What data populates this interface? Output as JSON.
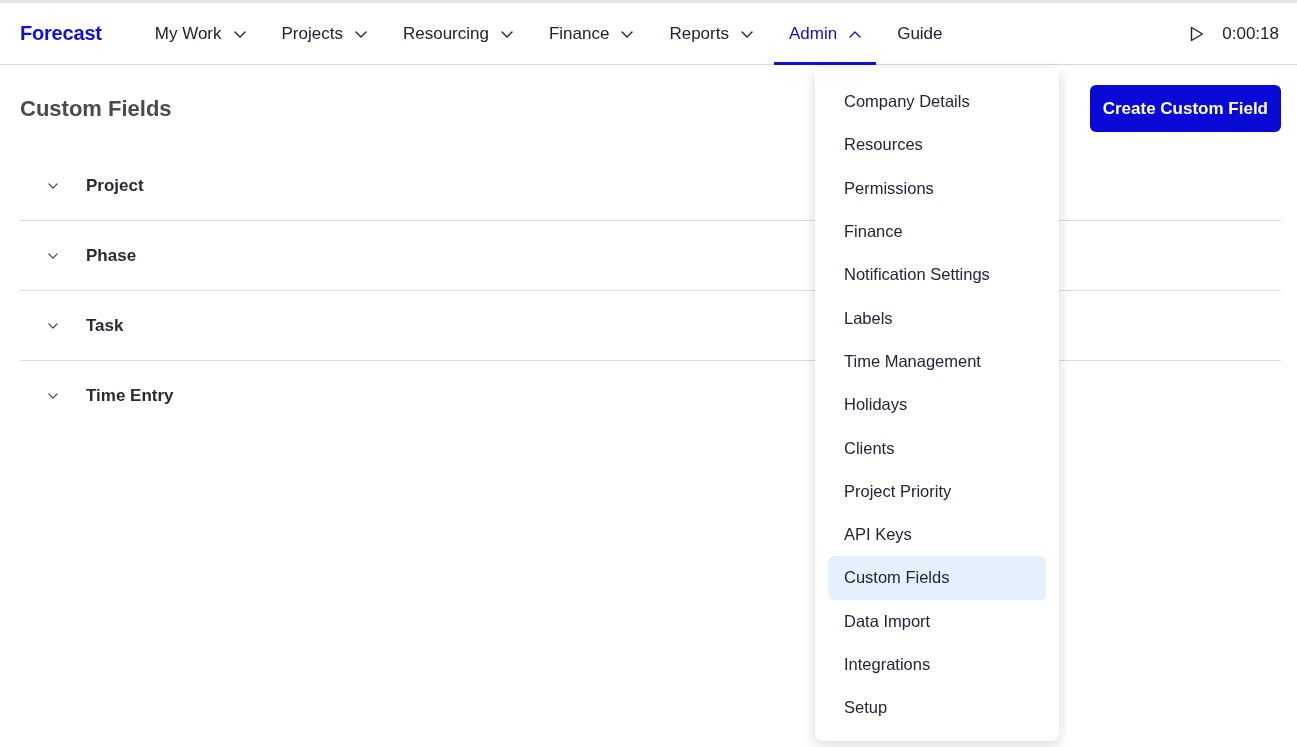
{
  "header": {
    "logo": "Forecast",
    "nav": [
      {
        "label": "My Work",
        "kind": "menu",
        "selected": false,
        "expanded": false
      },
      {
        "label": "Projects",
        "kind": "menu",
        "selected": false,
        "expanded": false
      },
      {
        "label": "Resourcing",
        "kind": "menu",
        "selected": false,
        "expanded": false
      },
      {
        "label": "Finance",
        "kind": "menu",
        "selected": false,
        "expanded": false
      },
      {
        "label": "Reports",
        "kind": "menu",
        "selected": false,
        "expanded": false
      },
      {
        "label": "Admin",
        "kind": "menu",
        "selected": true,
        "expanded": true
      },
      {
        "label": "Guide",
        "kind": "link",
        "selected": false
      }
    ],
    "timer": {
      "time": "0:00:18"
    }
  },
  "page": {
    "title": "Custom Fields",
    "create_button": "Create Custom Field",
    "sections": [
      {
        "label": "Project",
        "expanded": false
      },
      {
        "label": "Phase",
        "expanded": false
      },
      {
        "label": "Task",
        "expanded": false
      },
      {
        "label": "Time Entry",
        "expanded": false
      }
    ]
  },
  "admin_menu": {
    "items": [
      {
        "label": "Company Details",
        "selected": false
      },
      {
        "label": "Resources",
        "selected": false
      },
      {
        "label": "Permissions",
        "selected": false
      },
      {
        "label": "Finance",
        "selected": false
      },
      {
        "label": "Notification Settings",
        "selected": false
      },
      {
        "label": "Labels",
        "selected": false
      },
      {
        "label": "Time Management",
        "selected": false
      },
      {
        "label": "Holidays",
        "selected": false
      },
      {
        "label": "Clients",
        "selected": false
      },
      {
        "label": "Project Priority",
        "selected": false
      },
      {
        "label": "API Keys",
        "selected": false
      },
      {
        "label": "Custom Fields",
        "selected": true
      },
      {
        "label": "Data Import",
        "selected": false
      },
      {
        "label": "Integrations",
        "selected": false
      },
      {
        "label": "Setup",
        "selected": false
      }
    ]
  }
}
